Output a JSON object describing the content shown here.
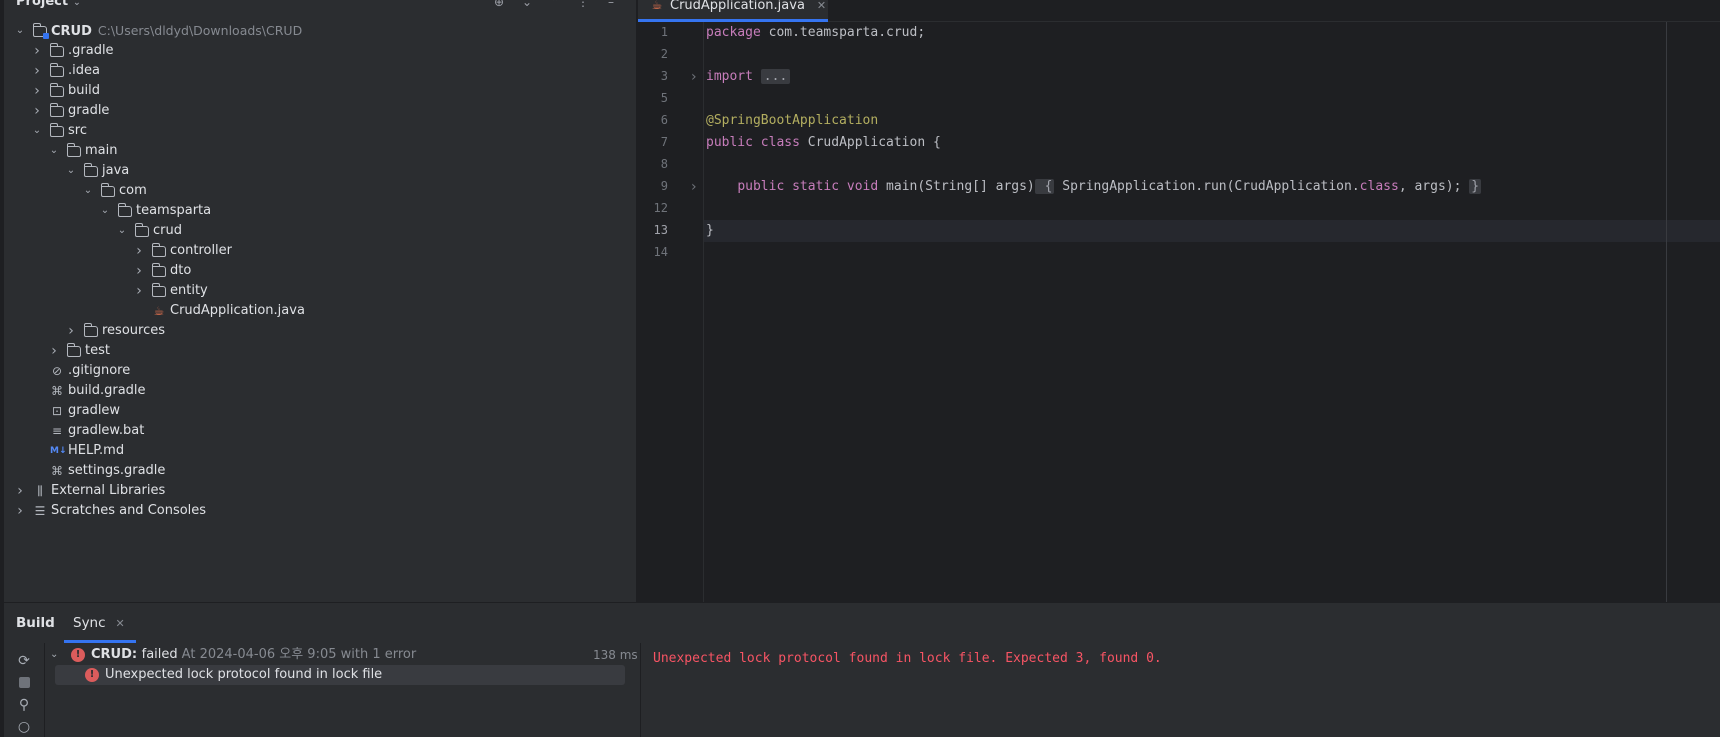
{
  "project": {
    "title": "Project",
    "tree": [
      {
        "label": "CRUD",
        "path": "C:\\Users\\dldyd\\Downloads\\CRUD",
        "type": "module",
        "depth": 0,
        "expanded": true
      },
      {
        "label": ".gradle",
        "type": "folder",
        "depth": 1,
        "expanded": false
      },
      {
        "label": ".idea",
        "type": "folder",
        "depth": 1,
        "expanded": false
      },
      {
        "label": "build",
        "type": "folder",
        "depth": 1,
        "expanded": false
      },
      {
        "label": "gradle",
        "type": "folder",
        "depth": 1,
        "expanded": false
      },
      {
        "label": "src",
        "type": "folder",
        "depth": 1,
        "expanded": true
      },
      {
        "label": "main",
        "type": "folder",
        "depth": 2,
        "expanded": true
      },
      {
        "label": "java",
        "type": "folder",
        "depth": 3,
        "expanded": true
      },
      {
        "label": "com",
        "type": "folder",
        "depth": 4,
        "expanded": true
      },
      {
        "label": "teamsparta",
        "type": "folder",
        "depth": 5,
        "expanded": true
      },
      {
        "label": "crud",
        "type": "folder",
        "depth": 6,
        "expanded": true
      },
      {
        "label": "controller",
        "type": "folder",
        "depth": 7,
        "expanded": false
      },
      {
        "label": "dto",
        "type": "folder",
        "depth": 7,
        "expanded": false
      },
      {
        "label": "entity",
        "type": "folder",
        "depth": 7,
        "expanded": false
      },
      {
        "label": "CrudApplication.java",
        "type": "java",
        "depth": 7
      },
      {
        "label": "resources",
        "type": "folder",
        "depth": 3,
        "expanded": false
      },
      {
        "label": "test",
        "type": "folder",
        "depth": 2,
        "expanded": false
      },
      {
        "label": ".gitignore",
        "type": "gitignore",
        "depth": 1
      },
      {
        "label": "build.gradle",
        "type": "gradle",
        "depth": 1
      },
      {
        "label": "gradlew",
        "type": "shell",
        "depth": 1
      },
      {
        "label": "gradlew.bat",
        "type": "text",
        "depth": 1
      },
      {
        "label": "HELP.md",
        "type": "markdown",
        "depth": 1
      },
      {
        "label": "settings.gradle",
        "type": "gradle",
        "depth": 1
      },
      {
        "label": "External Libraries",
        "type": "libraries",
        "depth": 0,
        "expanded": false
      },
      {
        "label": "Scratches and Consoles",
        "type": "scratches",
        "depth": 0,
        "expanded": false
      }
    ]
  },
  "editor": {
    "tab_label": "CrudApplication.java",
    "current_line": "13",
    "lines": [
      {
        "n": "1",
        "tokens": [
          {
            "t": "package ",
            "c": "kw2"
          },
          {
            "t": "com.teamsparta.crud;",
            "c": "plain"
          }
        ]
      },
      {
        "n": "2",
        "tokens": []
      },
      {
        "n": "3",
        "fold": true,
        "tokens": [
          {
            "t": "import ",
            "c": "kw2"
          },
          {
            "t": "...",
            "c": "foldbox"
          }
        ]
      },
      {
        "n": "5",
        "tokens": []
      },
      {
        "n": "6",
        "tokens": [
          {
            "t": "@SpringBootApplication",
            "c": "ann"
          }
        ]
      },
      {
        "n": "7",
        "tokens": [
          {
            "t": "public ",
            "c": "kw2"
          },
          {
            "t": "class ",
            "c": "kw2"
          },
          {
            "t": "CrudApplication {",
            "c": "plain"
          }
        ]
      },
      {
        "n": "8",
        "tokens": []
      },
      {
        "n": "9",
        "fold": true,
        "tokens": [
          {
            "t": "    ",
            "c": "plain"
          },
          {
            "t": "public ",
            "c": "kw2"
          },
          {
            "t": "static ",
            "c": "kw2"
          },
          {
            "t": "void ",
            "c": "kw2"
          },
          {
            "t": "main(String[] args)",
            "c": "plain"
          },
          {
            "t": " {",
            "c": "bracebox"
          },
          {
            "t": " SpringApplication.run(CrudApplication.",
            "c": "plain"
          },
          {
            "t": "class",
            "c": "kw2"
          },
          {
            "t": ", args); ",
            "c": "plain"
          },
          {
            "t": "}",
            "c": "bracebox"
          }
        ]
      },
      {
        "n": "12",
        "tokens": []
      },
      {
        "n": "13",
        "tokens": [
          {
            "t": "}",
            "c": "plain"
          }
        ]
      },
      {
        "n": "14",
        "tokens": []
      }
    ]
  },
  "build": {
    "tabs": [
      {
        "label": "Build"
      },
      {
        "label": "Sync"
      }
    ],
    "root": {
      "name": "CRUD:",
      "status": "failed",
      "meta": "At 2024-04-06 오후 9:05 with 1 error",
      "duration": "138 ms"
    },
    "child": {
      "message": "Unexpected lock protocol found in lock file"
    },
    "output": "Unexpected lock protocol found in lock file. Expected 3, found 0."
  }
}
